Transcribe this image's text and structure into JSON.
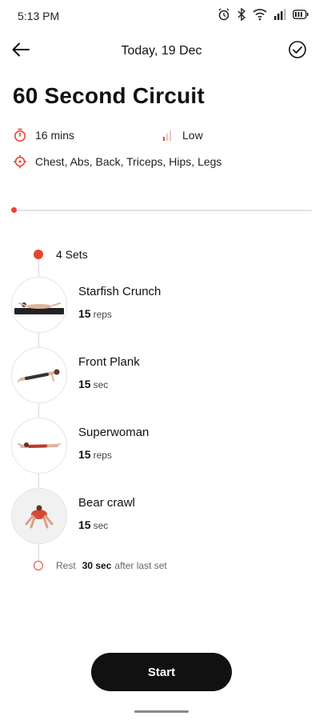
{
  "status_bar": {
    "time": "5:13 PM"
  },
  "header": {
    "title": "Today, 19 Dec"
  },
  "workout": {
    "title": "60 Second Circuit",
    "duration": "16 mins",
    "intensity": "Low",
    "muscles": "Chest, Abs, Back, Triceps, Hips, Legs"
  },
  "sets": {
    "label": "4 Sets"
  },
  "exercises": [
    {
      "name": "Starfish Crunch",
      "amount": "15",
      "unit": "reps"
    },
    {
      "name": "Front Plank",
      "amount": "15",
      "unit": "sec"
    },
    {
      "name": "Superwoman",
      "amount": "15",
      "unit": "reps"
    },
    {
      "name": "Bear crawl",
      "amount": "15",
      "unit": "sec"
    }
  ],
  "rest": {
    "label": "Rest",
    "value": "30 sec",
    "suffix": "after last set"
  },
  "actions": {
    "start_label": "Start"
  },
  "colors": {
    "accent": "#e8452e",
    "button": "#111111"
  }
}
